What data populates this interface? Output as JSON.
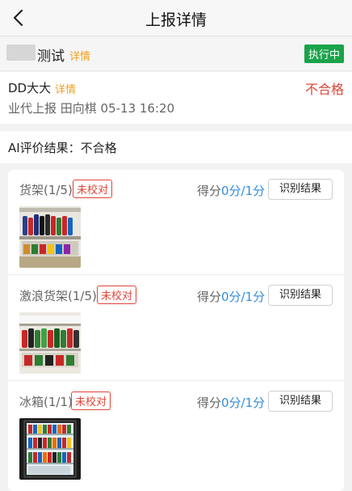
{
  "nav": {
    "title": "上报详情",
    "back_icon": "chevron-left-icon"
  },
  "store": {
    "name": "测试",
    "detail_link": "详情",
    "status": "执行中",
    "status_color": "#1aa34a"
  },
  "reporter": {
    "name": "DD大大",
    "detail_link": "详情",
    "result": "不合格",
    "result_color": "#e0453a",
    "meta": "业代上报 田向棋 05-13 16:20"
  },
  "ai": {
    "result_text": "AI评价结果：不合格"
  },
  "categories": [
    {
      "label": "货架(1/5)",
      "badge": "未校对",
      "score_label": "得分",
      "score_value": "0分/1分",
      "button": "识别结果"
    },
    {
      "label": "激浪货架(1/5)",
      "badge": "未校对",
      "score_label": "得分",
      "score_value": "0分/1分",
      "button": "识别结果"
    },
    {
      "label": "冰箱(1/1)",
      "badge": "未校对",
      "score_label": "得分",
      "score_value": "0分/1分",
      "button": "识别结果"
    }
  ],
  "colors": {
    "accent_orange": "#f0a020",
    "link_blue": "#2f8ee0",
    "alert_red": "#e0453a"
  }
}
